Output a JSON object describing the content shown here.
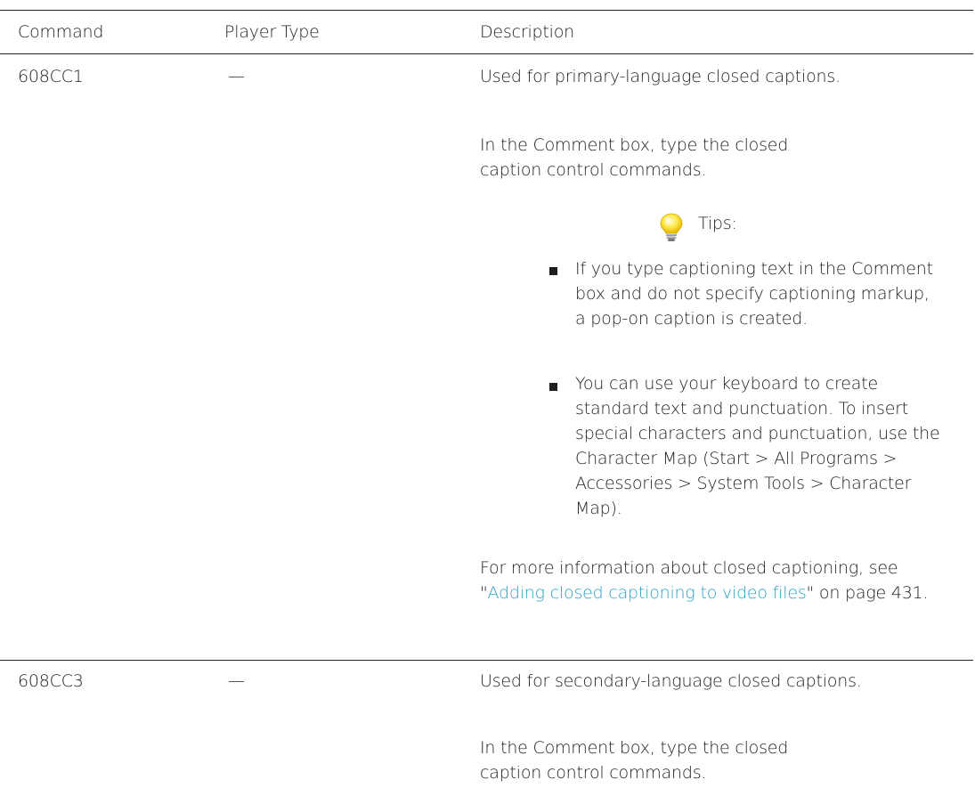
{
  "table": {
    "headers": {
      "command": "Command",
      "player_type": "Player Type",
      "description": "Description"
    },
    "rows": [
      {
        "command": "608CC1",
        "player_type": "—",
        "description_intro": "Used for primary-language closed captions.",
        "comment_instruction": "In the Comment box, type the closed caption control commands.",
        "tips_label": "Tips:",
        "tips": [
          "If you type captioning text in the Comment box and do not specify captioning markup, a pop-on caption is created.",
          "You can use your keyboard to create standard text and punctuation. To insert special characters and punctuation, use the Character Map (Start > All Programs > Accessories > System Tools > Character Map)."
        ],
        "more_info_prefix": "For more information about closed captioning, see \"",
        "more_info_link": "Adding closed captioning to video files",
        "more_info_suffix": "\" on page 431."
      },
      {
        "command": "608CC3",
        "player_type": "—",
        "description_intro": "Used for secondary-language closed captions.",
        "comment_instruction": "In the Comment box, type the closed caption control commands."
      }
    ]
  },
  "icons": {
    "tip_icon": "lightbulb-icon"
  },
  "colors": {
    "text": "#1e1e1e",
    "link": "#2aa3c6",
    "rule": "#222222"
  }
}
